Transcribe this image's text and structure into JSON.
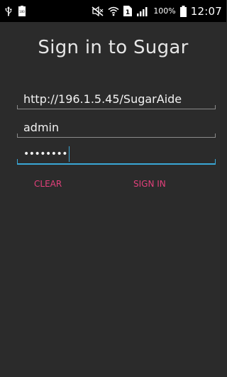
{
  "status_bar": {
    "time": "12:07",
    "battery_percent": "100%",
    "battery_small_label": "100",
    "sim_number": "1",
    "icons": [
      "usb-icon",
      "battery-small-icon",
      "mute-icon",
      "wifi-icon",
      "sim-icon",
      "signal-icon",
      "battery-icon"
    ]
  },
  "page": {
    "title": "Sign in to Sugar"
  },
  "form": {
    "url_value": "http://196.1.5.45/SugarAide",
    "username_value": "admin",
    "password_mask": "••••••••"
  },
  "actions": {
    "clear_label": "CLEAR",
    "signin_label": "SIGN IN"
  },
  "colors": {
    "background": "#2b2b2b",
    "accent_pink": "#e2407b",
    "focus_blue": "#3aa7d6"
  }
}
